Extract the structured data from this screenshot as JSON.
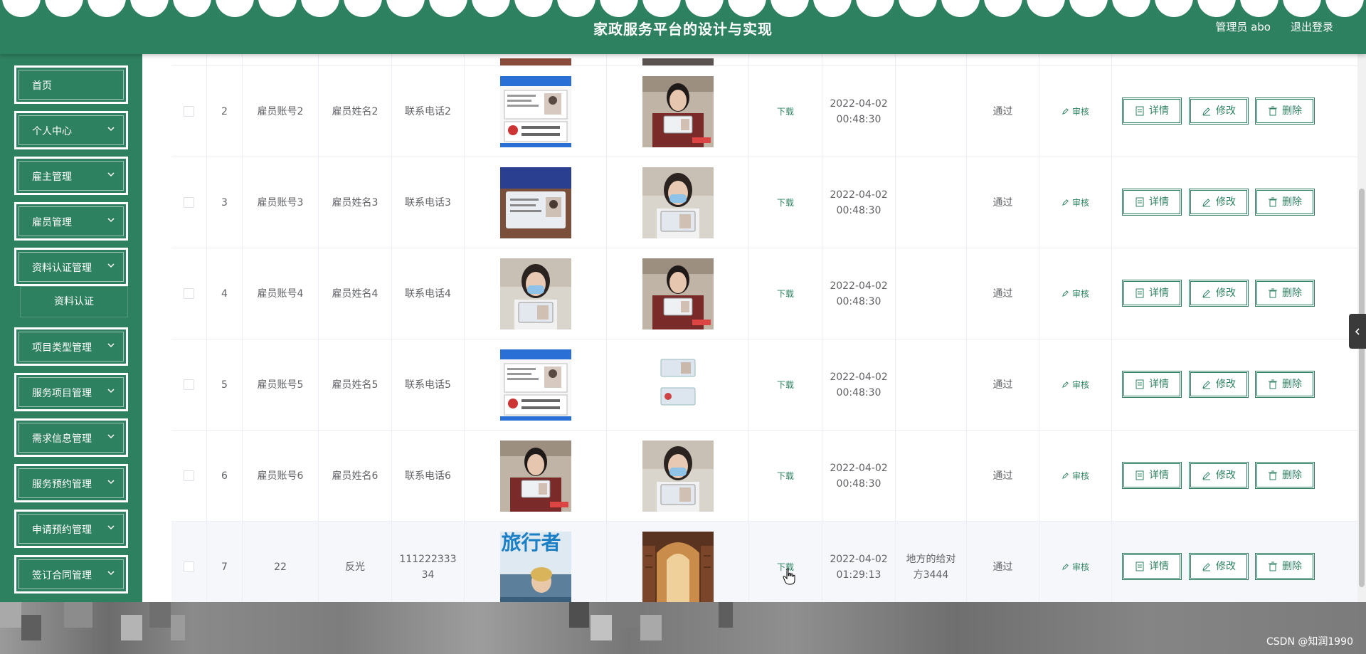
{
  "header": {
    "title": "家政服务平台的设计与实现",
    "user": "管理员 abo",
    "logout": "退出登录"
  },
  "sidebar": {
    "items": [
      {
        "label": "首页",
        "has_arrow": false
      },
      {
        "label": "个人中心",
        "has_arrow": true
      },
      {
        "label": "雇主管理",
        "has_arrow": true
      },
      {
        "label": "雇员管理",
        "has_arrow": true
      },
      {
        "label": "资料认证管理",
        "has_arrow": true
      },
      {
        "label": "项目类型管理",
        "has_arrow": true
      },
      {
        "label": "服务项目管理",
        "has_arrow": true
      },
      {
        "label": "需求信息管理",
        "has_arrow": true
      },
      {
        "label": "服务预约管理",
        "has_arrow": true
      },
      {
        "label": "申请预约管理",
        "has_arrow": true
      },
      {
        "label": "签订合同管理",
        "has_arrow": true
      }
    ],
    "submenu": "资料认证"
  },
  "table": {
    "rows": [
      {
        "index": "2",
        "account": "雇员账号2",
        "name": "雇员姓名2",
        "phone": "联系电话2",
        "download": "下载",
        "date": "2022-04-02",
        "time": "00:48:30",
        "remark": "",
        "status": "通过",
        "audit": "审核",
        "photo1": "id-card-doc",
        "photo2": "person-holding-id"
      },
      {
        "index": "3",
        "account": "雇员账号3",
        "name": "雇员姓名3",
        "phone": "联系电话3",
        "download": "下载",
        "date": "2022-04-02",
        "time": "00:48:30",
        "remark": "",
        "status": "通过",
        "audit": "审核",
        "photo1": "id-card-closeup",
        "photo2": "masked-person-id"
      },
      {
        "index": "4",
        "account": "雇员账号4",
        "name": "雇员姓名4",
        "phone": "联系电话4",
        "download": "下载",
        "date": "2022-04-02",
        "time": "00:48:30",
        "remark": "",
        "status": "通过",
        "audit": "审核",
        "photo1": "masked-person-id",
        "photo2": "person-holding-id"
      },
      {
        "index": "5",
        "account": "雇员账号5",
        "name": "雇员姓名5",
        "phone": "联系电话5",
        "download": "下载",
        "date": "2022-04-02",
        "time": "00:48:30",
        "remark": "",
        "status": "通过",
        "audit": "审核",
        "photo1": "id-card-doc",
        "photo2": "id-card-small"
      },
      {
        "index": "6",
        "account": "雇员账号6",
        "name": "雇员姓名6",
        "phone": "联系电话6",
        "download": "下载",
        "date": "2022-04-02",
        "time": "00:48:30",
        "remark": "",
        "status": "通过",
        "audit": "审核",
        "photo1": "person-holding-id",
        "photo2": "masked-person-id"
      },
      {
        "index": "7",
        "account": "22",
        "name": "反光",
        "phone_line1": "111222333",
        "phone_line2": "34",
        "download": "下载",
        "date": "2022-04-02",
        "time": "01:29:13",
        "remark_line1": "地方的给对",
        "remark_line2": "方3444",
        "status": "通过",
        "audit": "审核",
        "photo1": "magazine-cover",
        "photo1_text": "旅行者",
        "photo2": "library-hall"
      }
    ],
    "buttons": {
      "detail": "详情",
      "edit": "修改",
      "delete": "删除"
    }
  },
  "watermark": "CSDN @知润1990",
  "colors": {
    "primary": "#2e8160",
    "header_text": "#ffffff",
    "border": "#ebeef5"
  }
}
